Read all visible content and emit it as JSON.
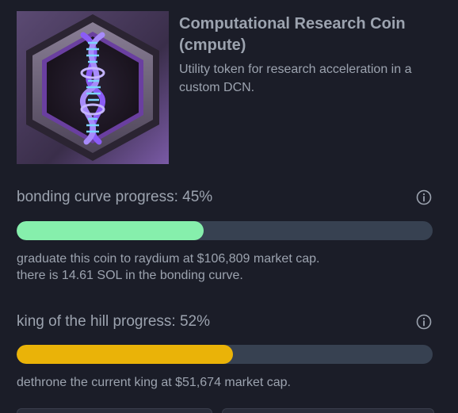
{
  "coin": {
    "name": "Computational Research Coin (cmpute)",
    "description": "Utility token for research acceleration in a custom DCN.",
    "image_icon": "dna-helix-hexagon-icon"
  },
  "bonding_curve": {
    "label": "bonding curve progress: 45%",
    "progress_percent": 45,
    "bar_color": "#86efac",
    "note_line1": "graduate this coin to raydium at $106,809 market cap.",
    "note_line2": "there is 14.61 SOL in the bonding curve.",
    "info_icon": "info-icon"
  },
  "king_of_the_hill": {
    "label": "king of the hill progress: 52%",
    "progress_percent": 52,
    "bar_color": "#eab308",
    "note": "dethrone the current king at $51,674 market cap.",
    "info_icon": "info-icon"
  },
  "colors": {
    "background": "#1b1d28",
    "text": "#9ca3af",
    "track": "#374151"
  }
}
